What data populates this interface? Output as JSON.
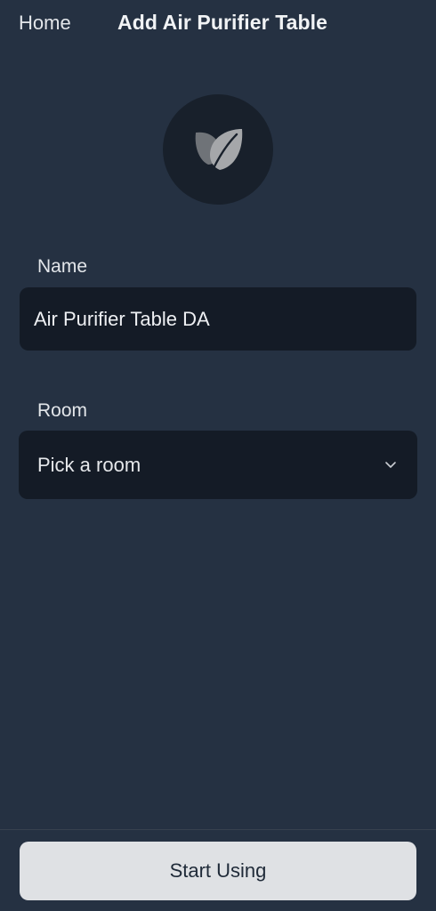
{
  "header": {
    "back_label": "Home",
    "title": "Add Air Purifier Table"
  },
  "device_icon": {
    "icon": "leaf-icon",
    "color": "#a5a7aa"
  },
  "form": {
    "name": {
      "label": "Name",
      "value": "Air Purifier Table DA"
    },
    "room": {
      "label": "Room",
      "selected": "Pick a room",
      "icon": "chevron-down-icon"
    }
  },
  "footer": {
    "start_label": "Start Using"
  },
  "colors": {
    "background": "#253142",
    "field_background": "#141b26",
    "button_background": "#dfe1e4"
  }
}
